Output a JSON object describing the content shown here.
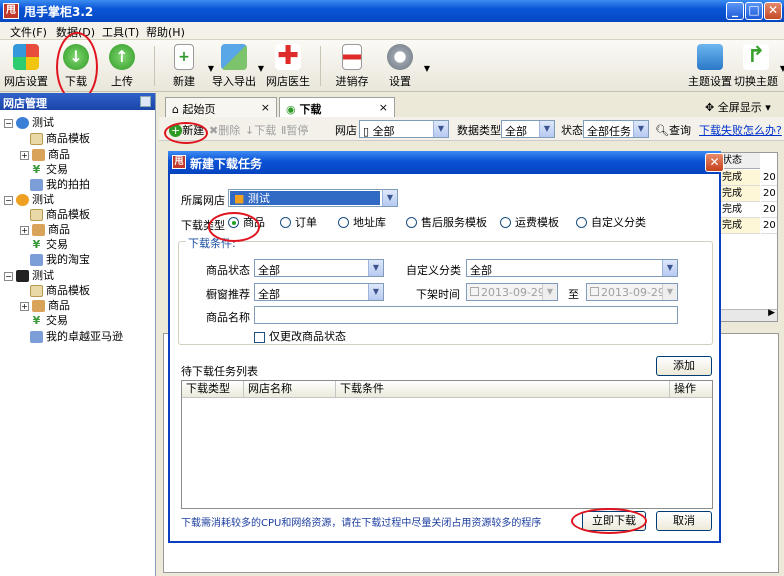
{
  "window": {
    "title": "甩手掌柜3.2",
    "app_icon": "甩"
  },
  "menu": [
    "文件(F)",
    "数据(D)",
    "工具(T)",
    "帮助(H)"
  ],
  "toolbar": {
    "shop_settings": "网店设置",
    "download": "下载",
    "upload": "上传",
    "new": "新建",
    "import_export": "导入导出",
    "shop_doctor": "网店医生",
    "inventory": "进销存",
    "settings": "设置",
    "theme_settings": "主题设置",
    "switch_theme": "切换主题"
  },
  "left_panel": {
    "title": "网店管理",
    "shops": [
      {
        "name": "测试",
        "children": [
          "商品模板",
          "商品",
          "交易",
          "我的拍拍"
        ]
      },
      {
        "name": "测试",
        "children": [
          "商品模板",
          "商品",
          "交易",
          "我的淘宝"
        ]
      },
      {
        "name": "测试",
        "children": [
          "商品模板",
          "商品",
          "交易",
          "我的卓越亚马逊"
        ]
      }
    ]
  },
  "tabs": [
    {
      "label": "起始页"
    },
    {
      "label": "下载"
    }
  ],
  "fullscreen_label": "全屏显示",
  "subtoolbar": {
    "new": "新建",
    "delete": "删除",
    "download": "下载",
    "pause": "暂停",
    "shop_label": "网店",
    "shop_value": "全部",
    "datatype_label": "数据类型",
    "datatype_value": "全部",
    "status_label": "状态",
    "status_value": "全部任务",
    "query": "查询",
    "failed_link": "下载失败怎么办?"
  },
  "bg_table": {
    "header": "状态",
    "rows": [
      "完成",
      "完成",
      "完成",
      "完成"
    ],
    "col2": "20"
  },
  "dialog": {
    "title": "新建下载任务",
    "shop_label": "所属网店",
    "shop_value": "测试",
    "type_label": "下载类型",
    "types": [
      "商品",
      "订单",
      "地址库",
      "售后服务模板",
      "运费模板",
      "自定义分类"
    ],
    "selected_type": "商品",
    "conditions_legend": "下载条件:",
    "goods_status_label": "商品状态",
    "goods_status_value": "全部",
    "custom_category_label": "自定义分类",
    "custom_category_value": "全部",
    "showcase_label": "橱窗推荐",
    "showcase_value": "全部",
    "offshelf_label": "下架时间",
    "date_from": "2013-09-29",
    "date_to_sep": "至",
    "date_to": "2013-09-29",
    "goods_name_label": "商品名称",
    "goods_name_value": "",
    "only_status_label": "仅更改商品状态",
    "pending_label": "待下载任务列表",
    "add_button": "添加",
    "columns": [
      "下载类型",
      "网店名称",
      "下载条件",
      "操作"
    ],
    "footer_note": "下载需消耗较多的CPU和网络资源，请在下载过程中尽量关闭占用资源较多的程序",
    "download_now": "立即下载",
    "cancel": "取消"
  },
  "colors": {
    "titlebar": "#0a55d6",
    "highlight": "#e0141e",
    "link": "#0033cc"
  }
}
